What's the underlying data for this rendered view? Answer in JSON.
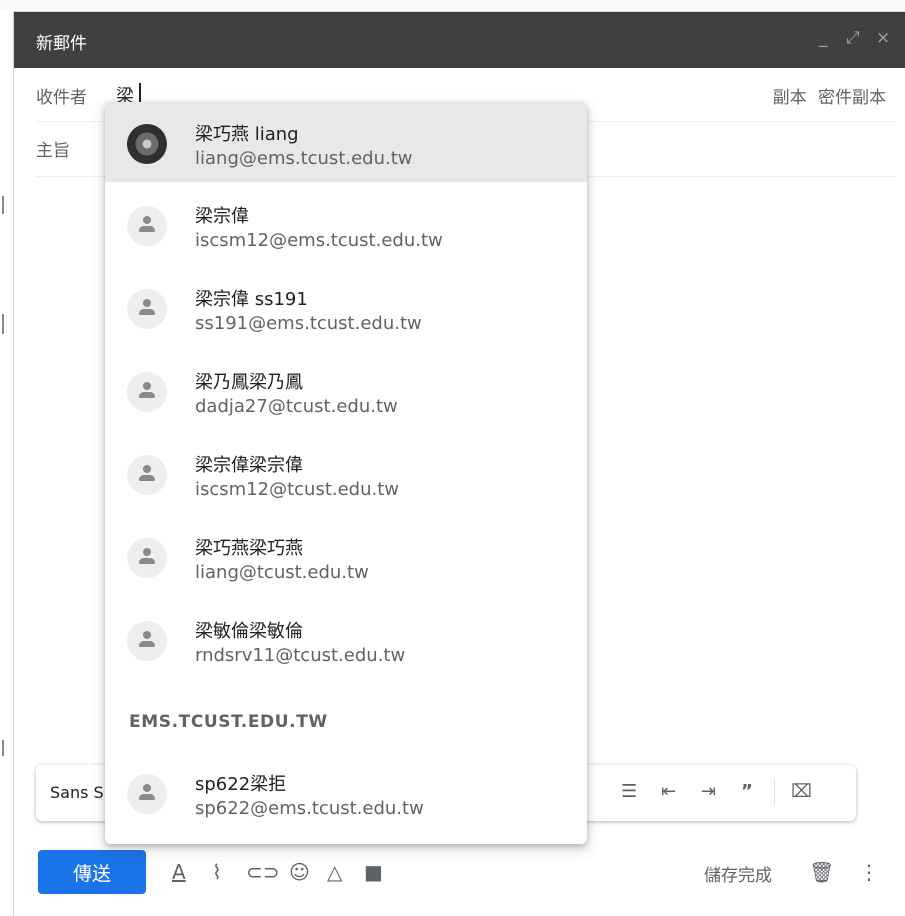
{
  "window": {
    "title": "新郵件",
    "controls": [
      "_",
      "⤢",
      "×"
    ]
  },
  "to": {
    "label": "收件者",
    "value": "梁",
    "cc": "副本",
    "bcc": "密件副本"
  },
  "subject": {
    "label": "主旨"
  },
  "suggestions": [
    {
      "name": "梁巧燕 liang",
      "email": "liang@ems.tcust.edu.tw",
      "avatar": "photo",
      "selected": true
    },
    {
      "name": "梁宗偉",
      "email": "iscsm12@ems.tcust.edu.tw",
      "avatar": "person-icon"
    },
    {
      "name": "梁宗偉 ss191",
      "email": "ss191@ems.tcust.edu.tw",
      "avatar": "person-icon"
    },
    {
      "name": "梁乃鳳梁乃鳳",
      "email": "dadja27@tcust.edu.tw",
      "avatar": "person-icon"
    },
    {
      "name": "梁宗偉梁宗偉",
      "email": "iscsm12@tcust.edu.tw",
      "avatar": "person-icon"
    },
    {
      "name": "梁巧燕梁巧燕",
      "email": "liang@tcust.edu.tw",
      "avatar": "person-icon"
    },
    {
      "name": "梁敏倫梁敏倫",
      "email": "rndsrv11@tcust.edu.tw",
      "avatar": "person-icon"
    }
  ],
  "group": {
    "header": "EMS.TCUST.EDU.TW",
    "items": [
      {
        "name": "sp622梁拒",
        "email": "sp622@ems.tcust.edu.tw",
        "avatar": "person-icon"
      }
    ]
  },
  "format_bar": {
    "font": "Sans S",
    "icons": [
      "bulleted-list-icon",
      "indent-less-icon",
      "indent-more-icon",
      "quote-icon",
      "remove-formatting-icon"
    ]
  },
  "bottom": {
    "send": "傳送",
    "save_status": "儲存完成",
    "icons": [
      "text-format-icon",
      "attach-icon",
      "link-icon",
      "emoji-icon",
      "drive-icon",
      "photo-icon",
      "trash-icon",
      "more-options-icon"
    ]
  },
  "colors": {
    "titlebar": "#404040",
    "send_button": "#1a73e8",
    "selected_row": "#e8e8e8"
  }
}
